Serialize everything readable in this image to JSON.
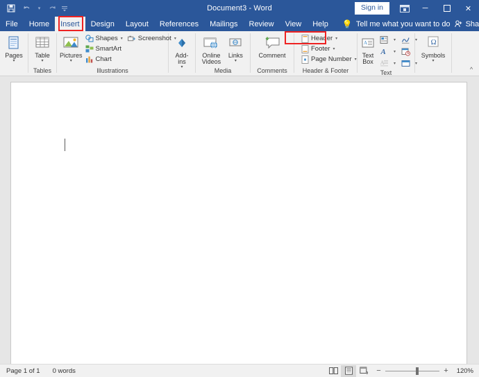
{
  "window": {
    "title": "Document3  -  Word",
    "quick_access": [
      {
        "name": "save-icon",
        "label": "Save"
      },
      {
        "name": "undo-icon",
        "label": "Undo"
      },
      {
        "name": "redo-icon",
        "label": "Redo"
      },
      {
        "name": "customize-quick-access-icon",
        "label": "Customize Quick Access Toolbar"
      }
    ],
    "sign_in_label": "Sign in",
    "ribbon_display_options": "ribbon-display-options-icon",
    "controls": {
      "minimize": "─",
      "maximize": "☐",
      "close": "✕"
    },
    "accent_color": "#2b579a",
    "highlight_color": "#ee2222"
  },
  "tabs": [
    {
      "label": "File",
      "active": false
    },
    {
      "label": "Home",
      "active": false
    },
    {
      "label": "Insert",
      "active": true
    },
    {
      "label": "Design",
      "active": false
    },
    {
      "label": "Layout",
      "active": false
    },
    {
      "label": "References",
      "active": false
    },
    {
      "label": "Mailings",
      "active": false
    },
    {
      "label": "Review",
      "active": false
    },
    {
      "label": "View",
      "active": false
    },
    {
      "label": "Help",
      "active": false
    }
  ],
  "tell_me": {
    "placeholder": "Tell me what you want to do",
    "icon": "lightbulb-icon"
  },
  "share": {
    "label": "Share",
    "icon": "share-person-icon"
  },
  "ribbon": {
    "groups": [
      {
        "label": "",
        "buttons": [
          {
            "label": "Pages",
            "label2": "",
            "icon": "pages-icon",
            "dropdown": true
          }
        ]
      },
      {
        "label": "Tables",
        "buttons": [
          {
            "label": "Table",
            "label2": "",
            "icon": "table-icon",
            "dropdown": true
          }
        ]
      },
      {
        "label": "Illustrations",
        "buttons": [
          {
            "label": "Pictures",
            "label2": "",
            "icon": "pictures-icon",
            "dropdown": true
          }
        ],
        "small_items": [
          {
            "label": "Shapes",
            "icon": "shapes-icon",
            "dropdown": true
          },
          {
            "label": "SmartArt",
            "icon": "smartart-icon",
            "dropdown": false
          },
          {
            "label": "Chart",
            "icon": "chart-icon",
            "dropdown": false
          }
        ],
        "small_items_2": [
          {
            "label": "Screenshot",
            "icon": "screenshot-icon",
            "dropdown": true
          }
        ]
      },
      {
        "label": "",
        "buttons": [
          {
            "label": "Add-",
            "label2": "ins",
            "icon": "add-ins-icon",
            "dropdown": true
          }
        ]
      },
      {
        "label": "Media",
        "buttons": [
          {
            "label": "Online",
            "label2": "Videos",
            "icon": "online-videos-icon",
            "dropdown": false
          },
          {
            "label": "Links",
            "label2": "",
            "icon": "links-icon",
            "dropdown": true
          }
        ]
      },
      {
        "label": "Comments",
        "buttons": [
          {
            "label": "Comment",
            "label2": "",
            "icon": "comment-icon",
            "dropdown": false
          }
        ]
      },
      {
        "label": "Header & Footer",
        "small_items": [
          {
            "label": "Header",
            "icon": "header-icon",
            "dropdown": true,
            "highlighted": true
          },
          {
            "label": "Footer",
            "icon": "footer-icon",
            "dropdown": true
          },
          {
            "label": "Page Number",
            "icon": "page-number-icon",
            "dropdown": true
          }
        ]
      },
      {
        "label": "Text",
        "buttons": [
          {
            "label": "Text",
            "label2": "Box",
            "icon": "text-box-icon",
            "dropdown": true
          }
        ],
        "mini_buttons": [
          {
            "icon": "drop-cap-icon",
            "dropdown": true
          },
          {
            "icon": "signature-line-icon",
            "dropdown": true
          },
          {
            "icon": "wordart-icon",
            "dropdown": true
          },
          {
            "icon": "date-time-icon",
            "dropdown": false
          },
          {
            "icon": "quick-parts-icon",
            "dropdown": true
          },
          {
            "icon": "object-icon",
            "dropdown": true
          }
        ]
      },
      {
        "label": "",
        "buttons": [
          {
            "label": "Symbols",
            "label2": "",
            "icon": "omega-symbol-icon",
            "dropdown": true
          }
        ]
      }
    ],
    "collapse_label": "collapse-ribbon-icon"
  },
  "document": {
    "page_background": "#ffffff",
    "canvas_background": "#7a7a7a",
    "cursor_visible": true
  },
  "status_bar": {
    "page_indicator": "Page 1 of 1",
    "word_count": "0 words",
    "view_buttons": [
      {
        "name": "read-mode-icon",
        "selected": false
      },
      {
        "name": "print-layout-icon",
        "selected": true
      },
      {
        "name": "web-layout-icon",
        "selected": false
      }
    ],
    "zoom_out": "−",
    "zoom_in": "+",
    "zoom_level": "120%",
    "zoom_slider_value": 120
  }
}
